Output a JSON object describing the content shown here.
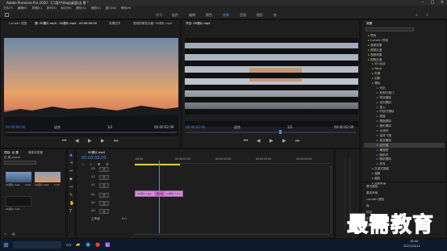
{
  "window": {
    "title": "Adobe Premiere Pro 2020 - C:\\用户\\Vlog\\桌面\\出 果 *"
  },
  "menu": [
    "文件(F)",
    "编辑(E)",
    "剪辑(C)",
    "序列(S)",
    "标记(M)",
    "图形(G)",
    "视图(V)",
    "窗口(W)",
    "帮助(H)"
  ],
  "workspaces": [
    "学习",
    "组件",
    "编辑",
    "颜色",
    "效果",
    "音频",
    "图形",
    "库"
  ],
  "workspace_active_index": 4,
  "source_monitor": {
    "tabs": [
      "Lumetri 范围",
      "源: 00源片.mp4 - 00源片.mp4 - 00:00:00:00",
      "效果控件",
      "音频剪辑混合器: 00源片.mp4"
    ],
    "timecode_left": "00:00:00:00",
    "fit": "适合",
    "page": "1/2",
    "timecode_right": "00:00:02:09"
  },
  "program_monitor": {
    "tab": "节目: 00源片.mp4",
    "timecode_left": "00:00:02:00",
    "fit": "适合",
    "page": "1/2",
    "timecode_right": "00:00:02:09"
  },
  "project": {
    "tabs": [
      "项目: 出 果",
      "媒体浏览器"
    ],
    "path": "出 果.prproj",
    "items": [
      {
        "name": "00源片.mp4",
        "duration": "2:09"
      },
      {
        "name": "00源片.mp4",
        "duration": "2:09"
      },
      {
        "name": "00源片.mp4",
        "duration": ""
      }
    ]
  },
  "timeline": {
    "tab": "00源片.mp4",
    "timecode": "00:00:02:00",
    "ruler": [
      ":00:00",
      "00:00:01:00",
      "00:00:02:00",
      "00:00:03:00",
      "00:00:04:00"
    ],
    "tracks": [
      "V3",
      "V2",
      "V1",
      "A1",
      "A2",
      "A3",
      "主声道"
    ],
    "master_value": "0.0",
    "clip1": "00源片.mp4",
    "clip2": "00源片.mp4",
    "transition": "百叶窗"
  },
  "effects": {
    "title": "效果",
    "items": [
      {
        "label": "预设",
        "indent": 1
      },
      {
        "label": "Lumetri 预设",
        "indent": 1
      },
      {
        "label": "音频效果",
        "indent": 1
      },
      {
        "label": "音频过渡",
        "indent": 1
      },
      {
        "label": "视频效果",
        "indent": 1
      },
      {
        "label": "视频过渡",
        "indent": 1
      },
      {
        "label": "3D 运动",
        "indent": 2
      },
      {
        "label": "Wipe",
        "indent": 2
      },
      {
        "label": "内滑",
        "indent": 2
      },
      {
        "label": "划像",
        "indent": 2
      },
      {
        "label": "擦除",
        "indent": 2
      },
      {
        "label": "划出",
        "indent": 3
      },
      {
        "label": "双侧平推门",
        "indent": 3
      },
      {
        "label": "带状擦除",
        "indent": 3
      },
      {
        "label": "径向擦除",
        "indent": 3
      },
      {
        "label": "插入",
        "indent": 3
      },
      {
        "label": "时钟式擦除",
        "indent": 3
      },
      {
        "label": "棋盘",
        "indent": 3
      },
      {
        "label": "棋盘擦除",
        "indent": 3
      },
      {
        "label": "楔形擦除",
        "indent": 3
      },
      {
        "label": "水波块",
        "indent": 3
      },
      {
        "label": "油漆飞溅",
        "indent": 3
      },
      {
        "label": "渐变擦除",
        "indent": 3
      },
      {
        "label": "百叶窗",
        "indent": 3,
        "selected": true
      },
      {
        "label": "螺旋框",
        "indent": 3
      },
      {
        "label": "随机块",
        "indent": 3
      },
      {
        "label": "随机擦除",
        "indent": 3
      },
      {
        "label": "风车",
        "indent": 3
      },
      {
        "label": "沉浸式视频",
        "indent": 2
      },
      {
        "label": "溶解",
        "indent": 2
      },
      {
        "label": "缩放",
        "indent": 2
      },
      {
        "label": "页面剥落",
        "indent": 2
      }
    ],
    "bottom_panels": [
      "基本图形",
      "基本声音",
      "Lumetri 颜色",
      "库",
      "标记",
      "历史记录",
      "信息"
    ]
  },
  "taskbar": {
    "time": "16:40",
    "date": "2021/10/12"
  },
  "watermark": "最需教育"
}
